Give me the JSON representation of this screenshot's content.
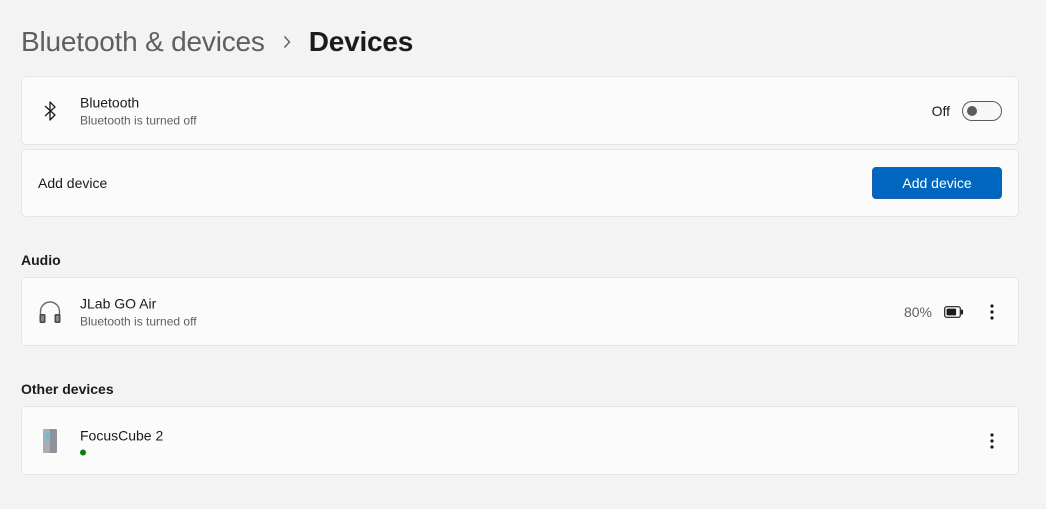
{
  "breadcrumb": {
    "parent": "Bluetooth & devices",
    "separator": "›",
    "current": "Devices"
  },
  "bluetooth": {
    "title": "Bluetooth",
    "subtitle": "Bluetooth is turned off",
    "toggle_label": "Off",
    "toggle_state": "off",
    "icon": "bluetooth-icon"
  },
  "add_device": {
    "label": "Add device",
    "button_label": "Add device"
  },
  "sections": {
    "audio": "Audio",
    "other": "Other devices"
  },
  "audio_devices": [
    {
      "name": "JLab GO Air",
      "status": "Bluetooth is turned off",
      "battery": "80%",
      "icon": "headphones-icon"
    }
  ],
  "other_devices": [
    {
      "name": "FocusCube 2",
      "status": "connected",
      "icon": "speaker-icon"
    }
  ],
  "colors": {
    "accent": "#0067c0",
    "background": "#f3f3f3",
    "card": "#fbfbfb",
    "status_green": "#0f7b0f"
  }
}
